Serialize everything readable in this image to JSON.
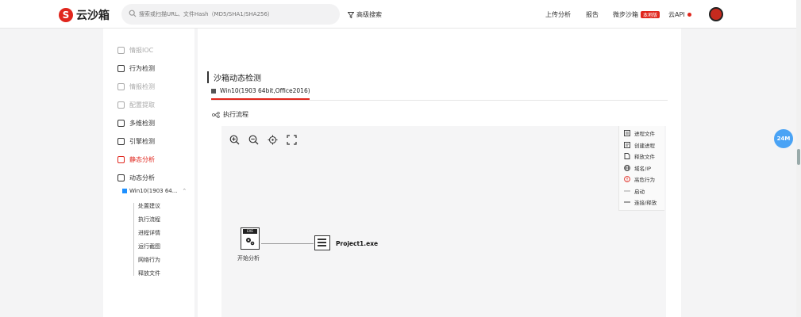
{
  "header": {
    "logo_text": "云沙箱",
    "search_placeholder": "搜索或扫描URL、文件Hash（MD5/SHA1/SHA256）",
    "advanced_search": "高级搜索",
    "nav": {
      "upload": "上传分析",
      "report": "报告",
      "micro_sandbox": "微步沙箱",
      "micro_badge": "本地版",
      "api": "云API"
    }
  },
  "sidebar": {
    "items": [
      {
        "label": "情报IOC",
        "icon": "ioc-icon",
        "state": "disabled"
      },
      {
        "label": "行为检测",
        "icon": "behavior-icon",
        "state": "normal"
      },
      {
        "label": "情报检测",
        "icon": "intel-icon",
        "state": "disabled"
      },
      {
        "label": "配置提取",
        "icon": "config-icon",
        "state": "disabled"
      },
      {
        "label": "多维检测",
        "icon": "multi-icon",
        "state": "normal"
      },
      {
        "label": "引擎检测",
        "icon": "engine-icon",
        "state": "normal"
      },
      {
        "label": "静态分析",
        "icon": "static-icon",
        "state": "active"
      },
      {
        "label": "动态分析",
        "icon": "dynamic-icon",
        "state": "normal"
      }
    ],
    "env": "Win10(1903 64...",
    "subitems": [
      "处置建议",
      "执行流程",
      "进程详情",
      "运行截图",
      "网络行为",
      "释放文件"
    ]
  },
  "main": {
    "section_title": "沙箱动态检测",
    "tab_label": "Win10(1903 64bit,Office2016)",
    "flow_title": "执行流程",
    "legend": [
      "进程文件",
      "创建进程",
      "释放文件",
      "域名/IP",
      "高危行为",
      "启动",
      "连接/释放"
    ],
    "start_label": "开始分析",
    "start_tag": "EXE",
    "process_label": "Project1.exe"
  },
  "float_badge": "24M",
  "colors": {
    "accent": "#e0261d",
    "badge_blue": "#4aa3f5"
  }
}
